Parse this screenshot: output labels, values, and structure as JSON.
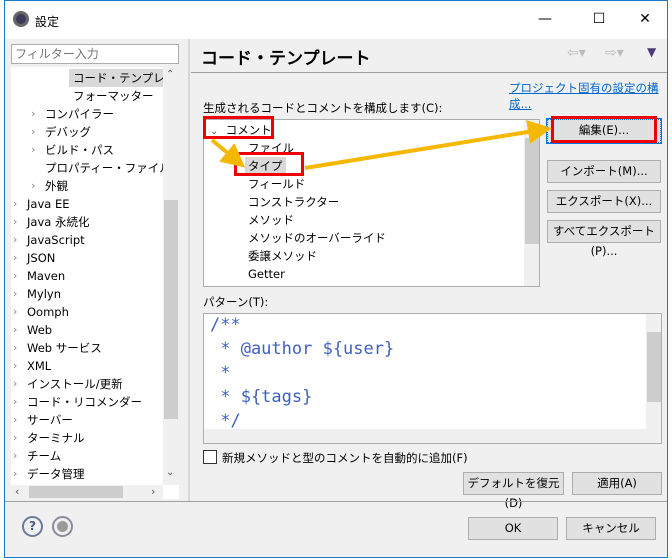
{
  "window": {
    "title": "設定",
    "icon": "gear-icon",
    "controls": [
      "minimize",
      "maximize",
      "close"
    ]
  },
  "sidebar": {
    "filter_placeholder": "フィルター入力",
    "items": [
      {
        "label": "コード・テンプレート",
        "selected": true,
        "expandable": false,
        "level": 3
      },
      {
        "label": "フォーマッター",
        "expandable": false,
        "level": 3
      },
      {
        "label": "コンパイラー",
        "expandable": true,
        "level": 2
      },
      {
        "label": "デバッグ",
        "expandable": true,
        "level": 2
      },
      {
        "label": "ビルド・パス",
        "expandable": true,
        "level": 2
      },
      {
        "label": "プロパティー・ファイル・エ",
        "expandable": false,
        "level": 2
      },
      {
        "label": "外観",
        "expandable": true,
        "level": 2
      },
      {
        "label": "Java EE",
        "expandable": true,
        "level": 1
      },
      {
        "label": "Java 永続化",
        "expandable": true,
        "level": 1
      },
      {
        "label": "JavaScript",
        "expandable": true,
        "level": 1
      },
      {
        "label": "JSON",
        "expandable": true,
        "level": 1
      },
      {
        "label": "Maven",
        "expandable": true,
        "level": 1
      },
      {
        "label": "Mylyn",
        "expandable": true,
        "level": 1
      },
      {
        "label": "Oomph",
        "expandable": true,
        "level": 1
      },
      {
        "label": "Web",
        "expandable": true,
        "level": 1
      },
      {
        "label": "Web サービス",
        "expandable": true,
        "level": 1
      },
      {
        "label": "XML",
        "expandable": true,
        "level": 1
      },
      {
        "label": "インストール/更新",
        "expandable": true,
        "level": 1
      },
      {
        "label": "コード・リコメンダー",
        "expandable": true,
        "level": 1
      },
      {
        "label": "サーバー",
        "expandable": true,
        "level": 1
      },
      {
        "label": "ターミナル",
        "expandable": true,
        "level": 1
      },
      {
        "label": "チーム",
        "expandable": true,
        "level": 1
      },
      {
        "label": "データ管理",
        "expandable": true,
        "level": 1
      }
    ]
  },
  "main": {
    "title": "コード・テンプレート",
    "project_link": "プロジェクト固有の設定の構成...",
    "tree_label": "生成されるコードとコメントを構成します(C):",
    "tree": {
      "root": "コメント",
      "children": [
        "ファイル",
        "タイプ",
        "フィールド",
        "コンストラクター",
        "メソッド",
        "メソッドのオーバーライド",
        "委譲メソッド",
        "Getter"
      ],
      "selected": "タイプ"
    },
    "buttons": {
      "edit": "編集(E)...",
      "import": "インポート(M)...",
      "export": "エクスポート(X)...",
      "export_all": "すべてエクスポート(P)..."
    },
    "pattern_label": "パターン(T):",
    "pattern_lines": [
      "/**",
      " * @author ${user}",
      " *",
      " * ${tags}",
      " */"
    ],
    "checkbox_label": "新規メソッドと型のコメントを自動的に追加(F)",
    "checkbox_checked": false,
    "restore_defaults": "デフォルトを復元(D)",
    "apply": "適用(A)"
  },
  "footer": {
    "ok": "OK",
    "cancel": "キャンセル",
    "help_icon": "help-icon",
    "import_icon": "record-icon"
  },
  "colors": {
    "annotation_box": "#ee0000",
    "annotation_arrow": "#f5b800",
    "code": "#3f5fbf",
    "link": "#0066cc"
  }
}
